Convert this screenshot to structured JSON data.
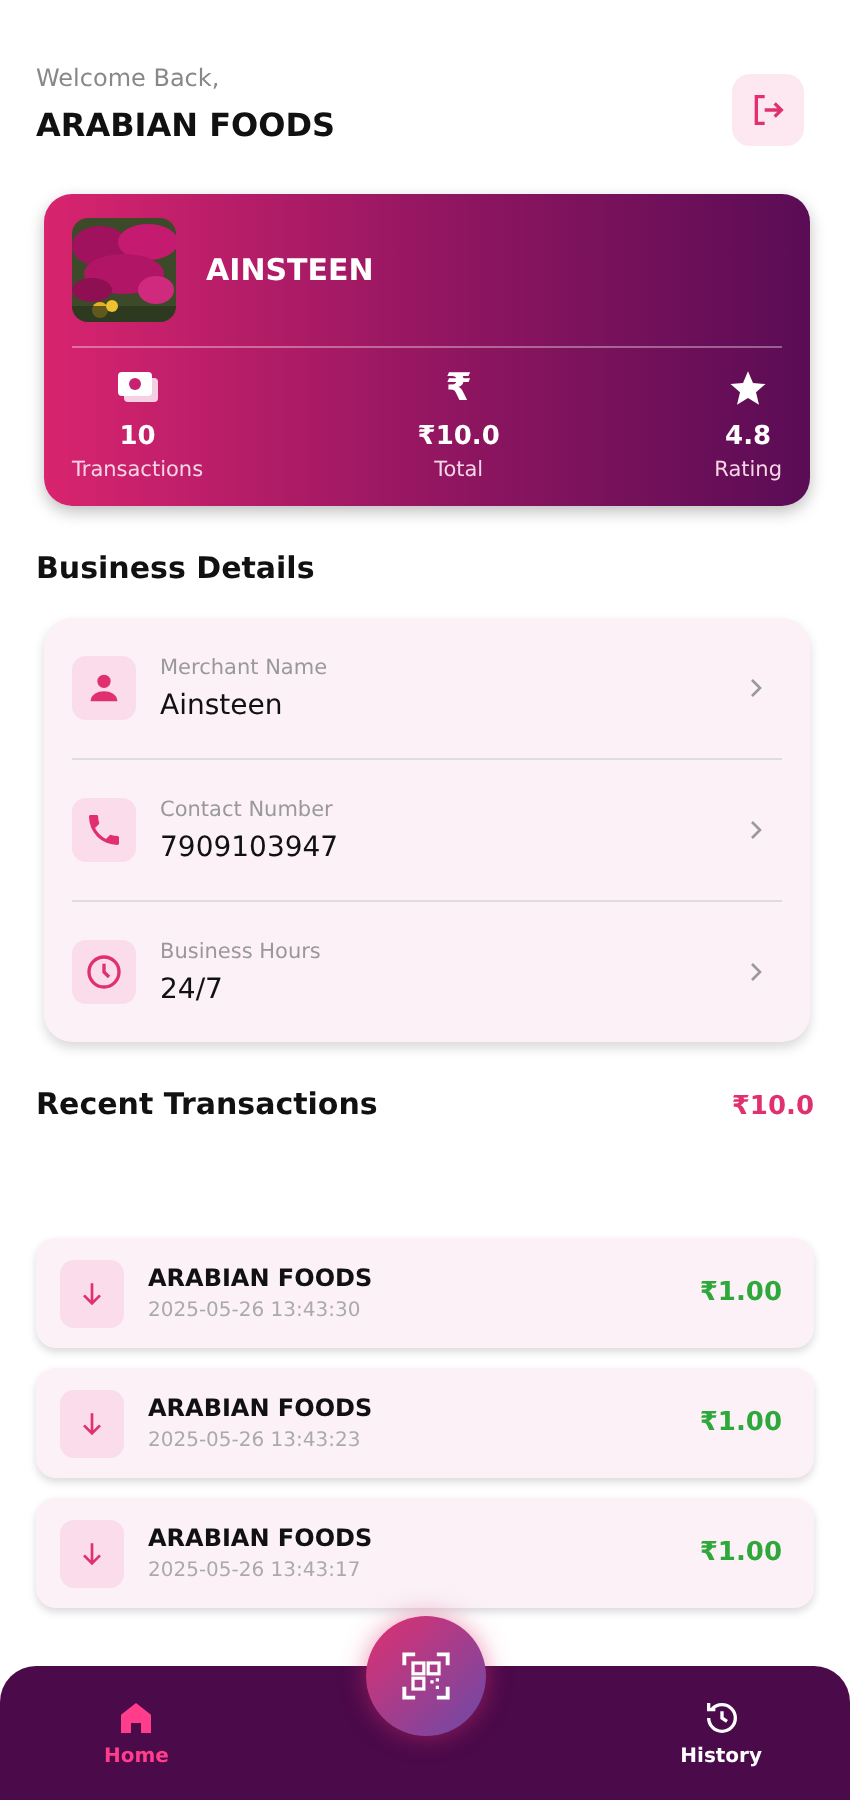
{
  "header": {
    "greeting": "Welcome Back,",
    "business_name": "ARABIAN FOODS"
  },
  "profile_card": {
    "name": "AINSTEEN",
    "stats": [
      {
        "kind": "cash",
        "value": "10",
        "label": "Transactions"
      },
      {
        "kind": "rupee",
        "icon": "₹",
        "value": "₹10.0",
        "label": "Total"
      },
      {
        "kind": "star",
        "value": "4.8",
        "label": "Rating"
      }
    ]
  },
  "business_details": {
    "title": "Business Details",
    "rows": [
      {
        "kind": "person",
        "label": "Merchant Name",
        "value": "Ainsteen"
      },
      {
        "kind": "phone",
        "label": "Contact Number",
        "value": "7909103947"
      },
      {
        "kind": "clock",
        "label": "Business Hours",
        "value": "24/7"
      }
    ]
  },
  "recent_transactions": {
    "title": "Recent Transactions",
    "total": "₹10.0",
    "items": [
      {
        "name": "ARABIAN FOODS",
        "time": "2025-05-26 13:43:30",
        "amount": "₹1.00"
      },
      {
        "name": "ARABIAN FOODS",
        "time": "2025-05-26 13:43:23",
        "amount": "₹1.00"
      },
      {
        "name": "ARABIAN FOODS",
        "time": "2025-05-26 13:43:17",
        "amount": "₹1.00"
      }
    ]
  },
  "bottom_nav": {
    "items": [
      {
        "kind": "home",
        "label": "Home",
        "selected": true
      },
      {
        "kind": "history",
        "label": "History",
        "selected": false
      }
    ]
  }
}
